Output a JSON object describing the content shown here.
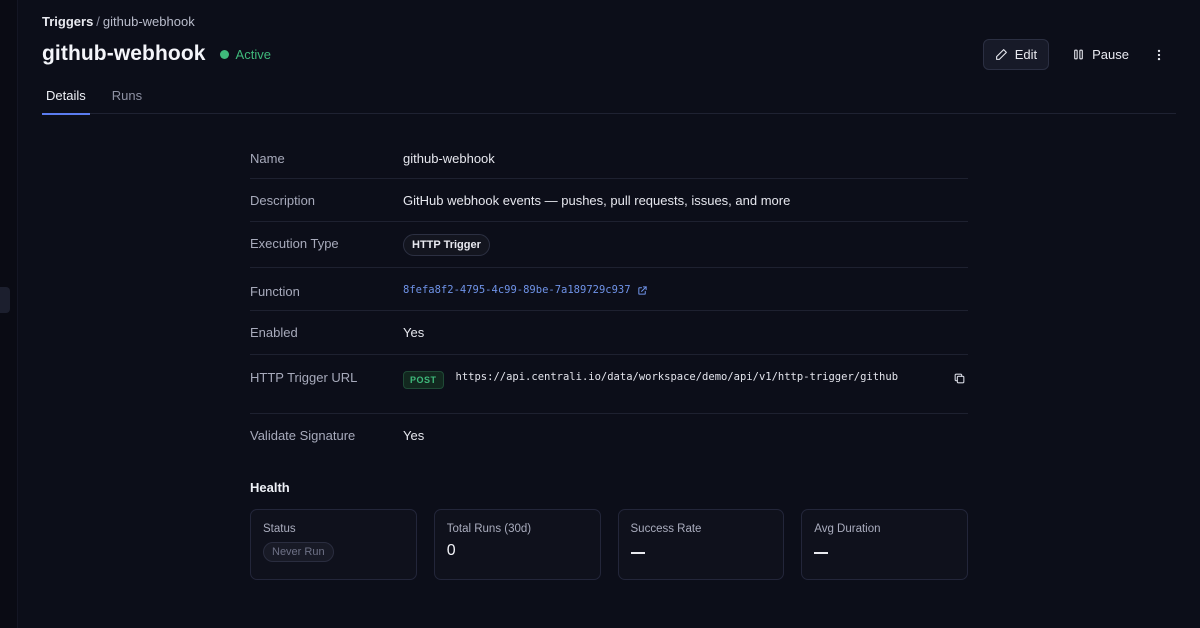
{
  "breadcrumb": {
    "root": "Triggers",
    "separator": "/",
    "current": "github-webhook"
  },
  "page": {
    "title": "github-webhook",
    "status": "Active",
    "status_color": "#3fb97b"
  },
  "actions": {
    "edit_label": "Edit",
    "pause_label": "Pause",
    "more_icon": "more-vertical-icon"
  },
  "tabs": [
    {
      "label": "Details",
      "active": true
    },
    {
      "label": "Runs",
      "active": false
    }
  ],
  "details": {
    "name": {
      "label": "Name",
      "value": "github-webhook"
    },
    "description": {
      "label": "Description",
      "value": "GitHub webhook events — pushes, pull requests, issues, and more"
    },
    "execution_type": {
      "label": "Execution Type",
      "value": "HTTP Trigger"
    },
    "function": {
      "label": "Function",
      "value": "8fefa8f2-4795-4c99-89be-7a189729c937"
    },
    "enabled": {
      "label": "Enabled",
      "value": "Yes"
    },
    "http_trigger_url": {
      "label": "HTTP Trigger URL",
      "method": "POST",
      "url": "https://api.centrali.io/data/workspace/demo/api/v1/http-trigger/github"
    },
    "validate_signature": {
      "label": "Validate Signature",
      "value": "Yes"
    }
  },
  "health": {
    "title": "Health",
    "cards": {
      "status": {
        "label": "Status",
        "value": "Never Run"
      },
      "total_runs": {
        "label": "Total Runs (30d)",
        "value": "0"
      },
      "success_rate": {
        "label": "Success Rate",
        "value": "—"
      },
      "avg_duration": {
        "label": "Avg Duration",
        "value": "—"
      }
    }
  },
  "colors": {
    "accent": "#5b7cf0",
    "link": "#6f93e8",
    "success": "#3fb97b",
    "background": "#0c0e19"
  }
}
